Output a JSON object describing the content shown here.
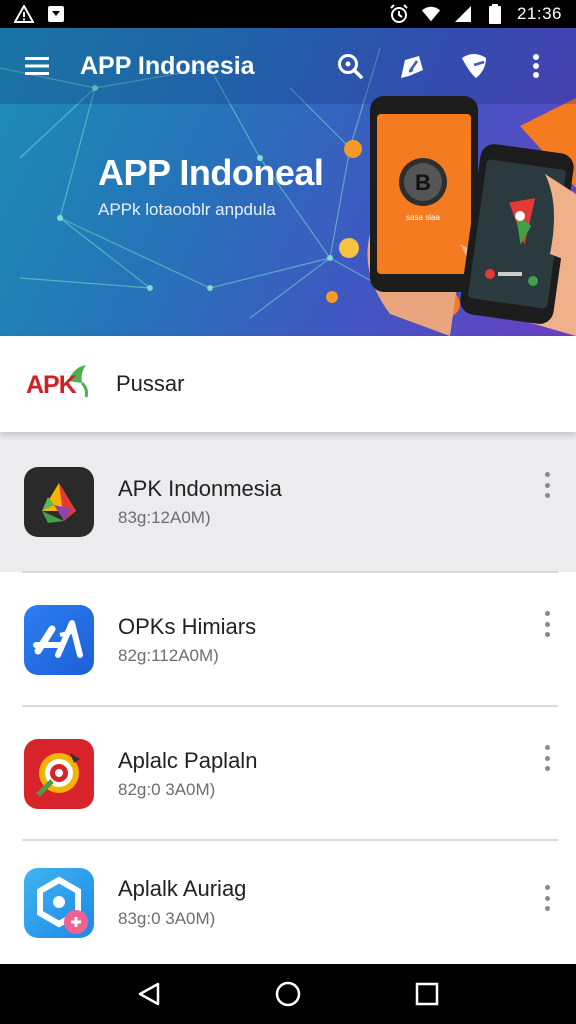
{
  "status_bar": {
    "time": "21:36",
    "left_icons": [
      "warning-icon",
      "notification-icon"
    ],
    "right_icons": [
      "alarm-icon",
      "wifi-icon",
      "signal-icon",
      "battery-icon"
    ]
  },
  "app_bar": {
    "title": "APP Indonesia",
    "icons": [
      "menu-icon",
      "search-icon",
      "edit-icon",
      "shield-icon",
      "more-vert-icon"
    ]
  },
  "banner": {
    "title": "APP Indoneal",
    "subtitle": "APPk lotaooblr anpdula",
    "phone_text": "sasa slaa"
  },
  "search": {
    "logo_text": "APK",
    "label": "Pussar"
  },
  "apps": [
    {
      "name": "APK Indonmesia",
      "size": "83g:12A0M)"
    },
    {
      "name": "OPKs Himiars",
      "size": "82g:112A0M)"
    },
    {
      "name": "Aplalc Paplaln",
      "size": "82g:0 3A0M)"
    },
    {
      "name": "Aplalk Auriag",
      "size": "83g:0 3A0M)"
    }
  ],
  "nav_bar": {
    "icons": [
      "back-icon",
      "home-icon",
      "recents-icon"
    ]
  },
  "colors": {
    "accent": "#3f58c2",
    "apk_red": "#d32027",
    "phone_orange": "#f47b20"
  }
}
